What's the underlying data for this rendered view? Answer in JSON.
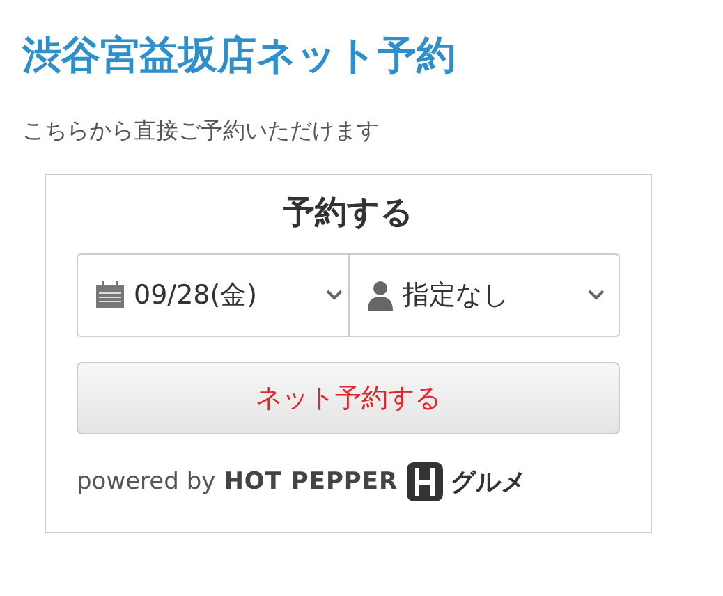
{
  "page": {
    "title": "渋谷宮益坂店ネット予約",
    "subtitle": "こちらから直接ご予約いただけます"
  },
  "reservation": {
    "heading": "予約する",
    "date_select": {
      "value": "09/28(金)"
    },
    "people_select": {
      "value": "指定なし"
    },
    "submit_button": "ネット予約する",
    "footer": {
      "powered_by": "powered by",
      "brand": "HOT PEPPER",
      "brand_suffix": "グルメ"
    }
  }
}
